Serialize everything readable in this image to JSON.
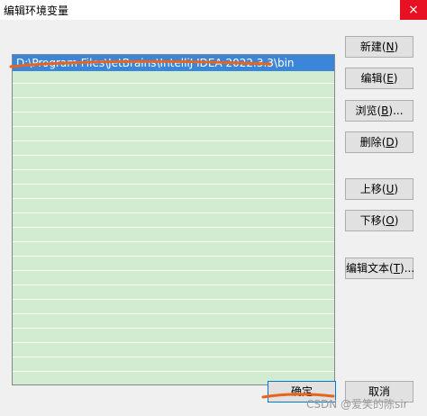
{
  "window": {
    "title": "编辑环境变量",
    "close_glyph": "×"
  },
  "list": {
    "items": [
      "D:\\Program Files\\JetBrains\\IntelliJ IDEA 2022.3.3\\bin"
    ],
    "selected_index": 0
  },
  "buttons": {
    "new": {
      "label": "新建",
      "accel": "N"
    },
    "edit": {
      "label": "编辑",
      "accel": "E"
    },
    "browse": {
      "label": "浏览",
      "accel": "B",
      "suffix": "..."
    },
    "delete": {
      "label": "删除",
      "accel": "D"
    },
    "move_up": {
      "label": "上移",
      "accel": "U"
    },
    "move_down": {
      "label": "下移",
      "accel": "O"
    },
    "edit_text": {
      "label": "编辑文本",
      "accel": "T",
      "suffix": "..."
    },
    "ok": {
      "label": "确定"
    },
    "cancel": {
      "label": "取消"
    }
  },
  "watermark": "CSDN @爱笑的陈sir",
  "colors": {
    "selection": "#3b86d8",
    "list_stripe": "#d2ecd2",
    "annotation": "#e8641c",
    "close_button": "#e81123"
  }
}
